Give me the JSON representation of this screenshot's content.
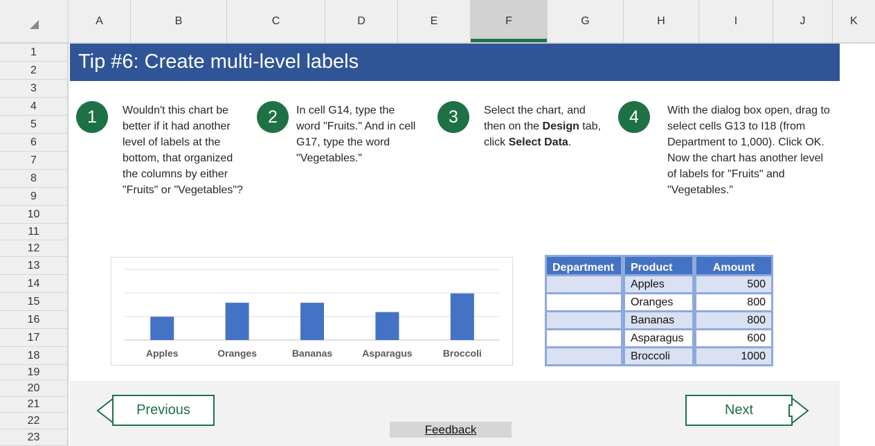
{
  "columns": [
    "A",
    "B",
    "C",
    "D",
    "E",
    "F",
    "G",
    "H",
    "I",
    "J",
    "K"
  ],
  "selected_column": "F",
  "rows": [
    "1",
    "2",
    "3",
    "4",
    "5",
    "6",
    "7",
    "8",
    "9",
    "10",
    "11",
    "12",
    "13",
    "14",
    "15",
    "16",
    "17",
    "18",
    "19",
    "20",
    "21",
    "22",
    "23"
  ],
  "banner": {
    "title": "Tip #6: Create multi-level labels"
  },
  "steps": [
    {
      "number": "1",
      "text": "Wouldn't this chart be better if it had another level of labels at the bottom, that organized the columns by either \"Fruits\" or \"Vegetables\"?"
    },
    {
      "number": "2",
      "text": "In cell G14, type the word \"Fruits.\" And in cell G17, type the word \"Vegetables.\""
    },
    {
      "number": "3",
      "text_before": "Select the chart, and then on the ",
      "bold1": "Design",
      "text_mid": " tab, click ",
      "bold2": "Select Data",
      "text_after": "."
    },
    {
      "number": "4",
      "text": "With the dialog box open, drag to select cells G13 to I18 (from Department to 1,000). Click OK. Now the chart has another level of labels for \"Fruits\" and \"Vegetables.\""
    }
  ],
  "chart_data": {
    "type": "bar",
    "categories": [
      "Apples",
      "Oranges",
      "Bananas",
      "Asparagus",
      "Broccoli"
    ],
    "values": [
      500,
      800,
      800,
      600,
      1000
    ],
    "title": "",
    "xlabel": "",
    "ylabel": "",
    "ylim": [
      0,
      1000
    ],
    "grid": true,
    "bar_color": "#4472c4"
  },
  "table": {
    "headers": [
      "Department",
      "Product",
      "Amount"
    ],
    "rows": [
      [
        "",
        "Apples",
        "500"
      ],
      [
        "",
        "Oranges",
        "800"
      ],
      [
        "",
        "Bananas",
        "800"
      ],
      [
        "",
        "Asparagus",
        "600"
      ],
      [
        "",
        "Broccoli",
        "1000"
      ]
    ],
    "header_color": "#4472c4",
    "band_color": "#d9e1f2"
  },
  "footer": {
    "previous_label": "Previous",
    "next_label": "Next",
    "feedback_label": "Feedback"
  },
  "colors": {
    "banner": "#2f5597",
    "accent_green": "#1e7145"
  }
}
